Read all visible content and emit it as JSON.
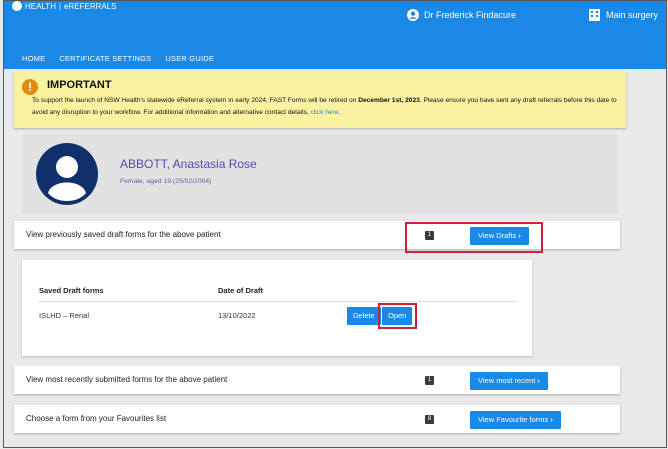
{
  "header": {
    "logo_text": "HEALTH",
    "app_name": "eREFERRALS",
    "user_name": "Dr Frederick Findacure",
    "site_name": "Main surgery",
    "nav": [
      "HOME",
      "CERTIFICATE SETTINGS",
      "USER GUIDE"
    ],
    "bg_color": "#1a88e6"
  },
  "alert": {
    "icon": "exclamation-icon",
    "title": "IMPORTANT",
    "text_1": "To support the launch of NSW Health's statewide eReferral system in early 2024, FAST Forms will be retired on ",
    "date": "December 1st, 2023",
    "text_2": ". Please ensure you have sent any draft referrals before this date to avoid any disruption to your workflow. For additional information and alternative contact details, ",
    "link": "click here",
    "text_3": "."
  },
  "patient": {
    "name": "ABBOTT, Anastasia Rose",
    "details": "Female, aged 19 (25/02/2004)"
  },
  "drafts_row": {
    "label": "View previously saved draft forms for the above patient",
    "count": "1",
    "button": "View Drafts"
  },
  "drafts_table": {
    "headers": [
      "Saved Draft forms",
      "Date of Draft"
    ],
    "rows": [
      {
        "form": "ISLHD – Renal",
        "date": "13/10/2022",
        "delete": "Delete",
        "open": "Open"
      }
    ]
  },
  "recent_row": {
    "label": "View most recently submitted forms for the above patient",
    "count": "1",
    "button": "View most recent"
  },
  "favourites_row": {
    "label": "Choose a form from your Favourites list",
    "count": "8",
    "button": "View Favourite forms"
  },
  "colors": {
    "highlight": "#d0213b",
    "alert_bg": "#faf2a1",
    "button": "#1a88e6"
  }
}
